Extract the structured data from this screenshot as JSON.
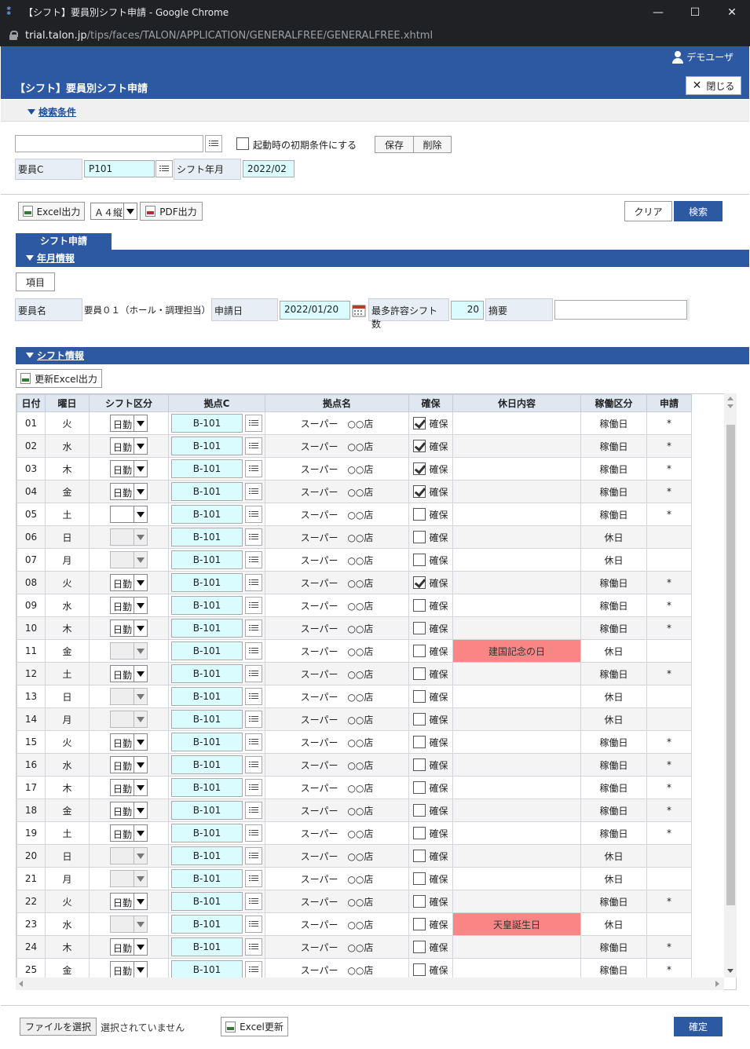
{
  "window": {
    "title": "【シフト】要員別シフト申請 - Google Chrome",
    "url_host": "trial.talon.jp",
    "url_path": "/tips/faces/TALON/APPLICATION/GENERALFREE/GENERALFREE.xhtml",
    "minimize": "—",
    "maximize": "☐",
    "close": "✕"
  },
  "header": {
    "user": "デモユーザ",
    "page_title": "【シフト】要員別シフト申請",
    "close_label": "閉じる"
  },
  "search": {
    "section_label": "検索条件",
    "condition_input": "",
    "startup_checkbox_label": "起動時の初期条件にする",
    "save_label": "保存",
    "delete_label": "削除",
    "staff_code_label": "要員C",
    "staff_code_value": "P101",
    "shift_month_label": "シフト年月",
    "shift_month_value": "2022/02"
  },
  "toolbar": {
    "excel_label": "Excel出力",
    "paper_value": "Ａ４縦",
    "pdf_label": "PDF出力",
    "clear_label": "クリア",
    "search_label": "検索"
  },
  "tab": {
    "label": "シフト申請"
  },
  "monthinfo": {
    "section_label": "年月情報",
    "item_button": "項目",
    "staff_name_label": "要員名",
    "staff_name_value": "要員０１（ホール・調理担当）",
    "apply_date_label": "申請日",
    "apply_date_value": "2022/01/20",
    "max_shift_label": "最多許容シフト数",
    "max_shift_value": "20",
    "summary_label": "摘要",
    "summary_value": ""
  },
  "shiftinfo": {
    "section_label": "シフト情報",
    "excel_update_out": "更新Excel出力",
    "columns": [
      "日付",
      "曜日",
      "シフト区分",
      "拠点C",
      "拠点名",
      "確保",
      "休日内容",
      "稼働区分",
      "申請"
    ],
    "rows": [
      {
        "d": "01",
        "w": "火",
        "k": "日勤",
        "c": "B-101",
        "n": "スーパー　○○店",
        "kk": true,
        "h": "",
        "s": "稼働日",
        "a": "*"
      },
      {
        "d": "02",
        "w": "水",
        "k": "日勤",
        "c": "B-101",
        "n": "スーパー　○○店",
        "kk": true,
        "h": "",
        "s": "稼働日",
        "a": "*"
      },
      {
        "d": "03",
        "w": "木",
        "k": "日勤",
        "c": "B-101",
        "n": "スーパー　○○店",
        "kk": true,
        "h": "",
        "s": "稼働日",
        "a": "*"
      },
      {
        "d": "04",
        "w": "金",
        "k": "日勤",
        "c": "B-101",
        "n": "スーパー　○○店",
        "kk": true,
        "h": "",
        "s": "稼働日",
        "a": "*"
      },
      {
        "d": "05",
        "w": "土",
        "k": "",
        "c": "B-101",
        "n": "スーパー　○○店",
        "kk": false,
        "h": "",
        "s": "稼働日",
        "a": "*"
      },
      {
        "d": "06",
        "w": "日",
        "k": "-",
        "c": "B-101",
        "n": "スーパー　○○店",
        "kk": false,
        "h": "",
        "s": "休日",
        "a": ""
      },
      {
        "d": "07",
        "w": "月",
        "k": "-",
        "c": "B-101",
        "n": "スーパー　○○店",
        "kk": false,
        "h": "",
        "s": "休日",
        "a": ""
      },
      {
        "d": "08",
        "w": "火",
        "k": "日勤",
        "c": "B-101",
        "n": "スーパー　○○店",
        "kk": true,
        "h": "",
        "s": "稼働日",
        "a": "*"
      },
      {
        "d": "09",
        "w": "水",
        "k": "日勤",
        "c": "B-101",
        "n": "スーパー　○○店",
        "kk": false,
        "h": "",
        "s": "稼働日",
        "a": "*"
      },
      {
        "d": "10",
        "w": "木",
        "k": "日勤",
        "c": "B-101",
        "n": "スーパー　○○店",
        "kk": false,
        "h": "",
        "s": "稼働日",
        "a": "*"
      },
      {
        "d": "11",
        "w": "金",
        "k": "-",
        "c": "B-101",
        "n": "スーパー　○○店",
        "kk": false,
        "h": "建国記念の日",
        "s": "休日",
        "a": ""
      },
      {
        "d": "12",
        "w": "土",
        "k": "日勤",
        "c": "B-101",
        "n": "スーパー　○○店",
        "kk": false,
        "h": "",
        "s": "稼働日",
        "a": "*"
      },
      {
        "d": "13",
        "w": "日",
        "k": "-",
        "c": "B-101",
        "n": "スーパー　○○店",
        "kk": false,
        "h": "",
        "s": "休日",
        "a": ""
      },
      {
        "d": "14",
        "w": "月",
        "k": "-",
        "c": "B-101",
        "n": "スーパー　○○店",
        "kk": false,
        "h": "",
        "s": "休日",
        "a": ""
      },
      {
        "d": "15",
        "w": "火",
        "k": "日勤",
        "c": "B-101",
        "n": "スーパー　○○店",
        "kk": false,
        "h": "",
        "s": "稼働日",
        "a": "*"
      },
      {
        "d": "16",
        "w": "水",
        "k": "日勤",
        "c": "B-101",
        "n": "スーパー　○○店",
        "kk": false,
        "h": "",
        "s": "稼働日",
        "a": "*"
      },
      {
        "d": "17",
        "w": "木",
        "k": "日勤",
        "c": "B-101",
        "n": "スーパー　○○店",
        "kk": false,
        "h": "",
        "s": "稼働日",
        "a": "*"
      },
      {
        "d": "18",
        "w": "金",
        "k": "日勤",
        "c": "B-101",
        "n": "スーパー　○○店",
        "kk": false,
        "h": "",
        "s": "稼働日",
        "a": "*"
      },
      {
        "d": "19",
        "w": "土",
        "k": "日勤",
        "c": "B-101",
        "n": "スーパー　○○店",
        "kk": false,
        "h": "",
        "s": "稼働日",
        "a": "*"
      },
      {
        "d": "20",
        "w": "日",
        "k": "-",
        "c": "B-101",
        "n": "スーパー　○○店",
        "kk": false,
        "h": "",
        "s": "休日",
        "a": ""
      },
      {
        "d": "21",
        "w": "月",
        "k": "-",
        "c": "B-101",
        "n": "スーパー　○○店",
        "kk": false,
        "h": "",
        "s": "休日",
        "a": ""
      },
      {
        "d": "22",
        "w": "火",
        "k": "日勤",
        "c": "B-101",
        "n": "スーパー　○○店",
        "kk": false,
        "h": "",
        "s": "稼働日",
        "a": "*"
      },
      {
        "d": "23",
        "w": "水",
        "k": "-",
        "c": "B-101",
        "n": "スーパー　○○店",
        "kk": false,
        "h": "天皇誕生日",
        "s": "休日",
        "a": ""
      },
      {
        "d": "24",
        "w": "木",
        "k": "日勤",
        "c": "B-101",
        "n": "スーパー　○○店",
        "kk": false,
        "h": "",
        "s": "稼働日",
        "a": "*"
      },
      {
        "d": "25",
        "w": "金",
        "k": "日勤",
        "c": "B-101",
        "n": "スーパー　○○店",
        "kk": false,
        "h": "",
        "s": "稼働日",
        "a": "*"
      }
    ],
    "kakuho_label": "確保"
  },
  "footer": {
    "file_button": "ファイルを選択",
    "file_status": "選択されていません",
    "excel_update": "Excel更新",
    "confirm": "確定"
  },
  "colors": {
    "primary": "#2d58a2",
    "input_highlight": "#dbfcff",
    "holiday": "#f98585"
  }
}
